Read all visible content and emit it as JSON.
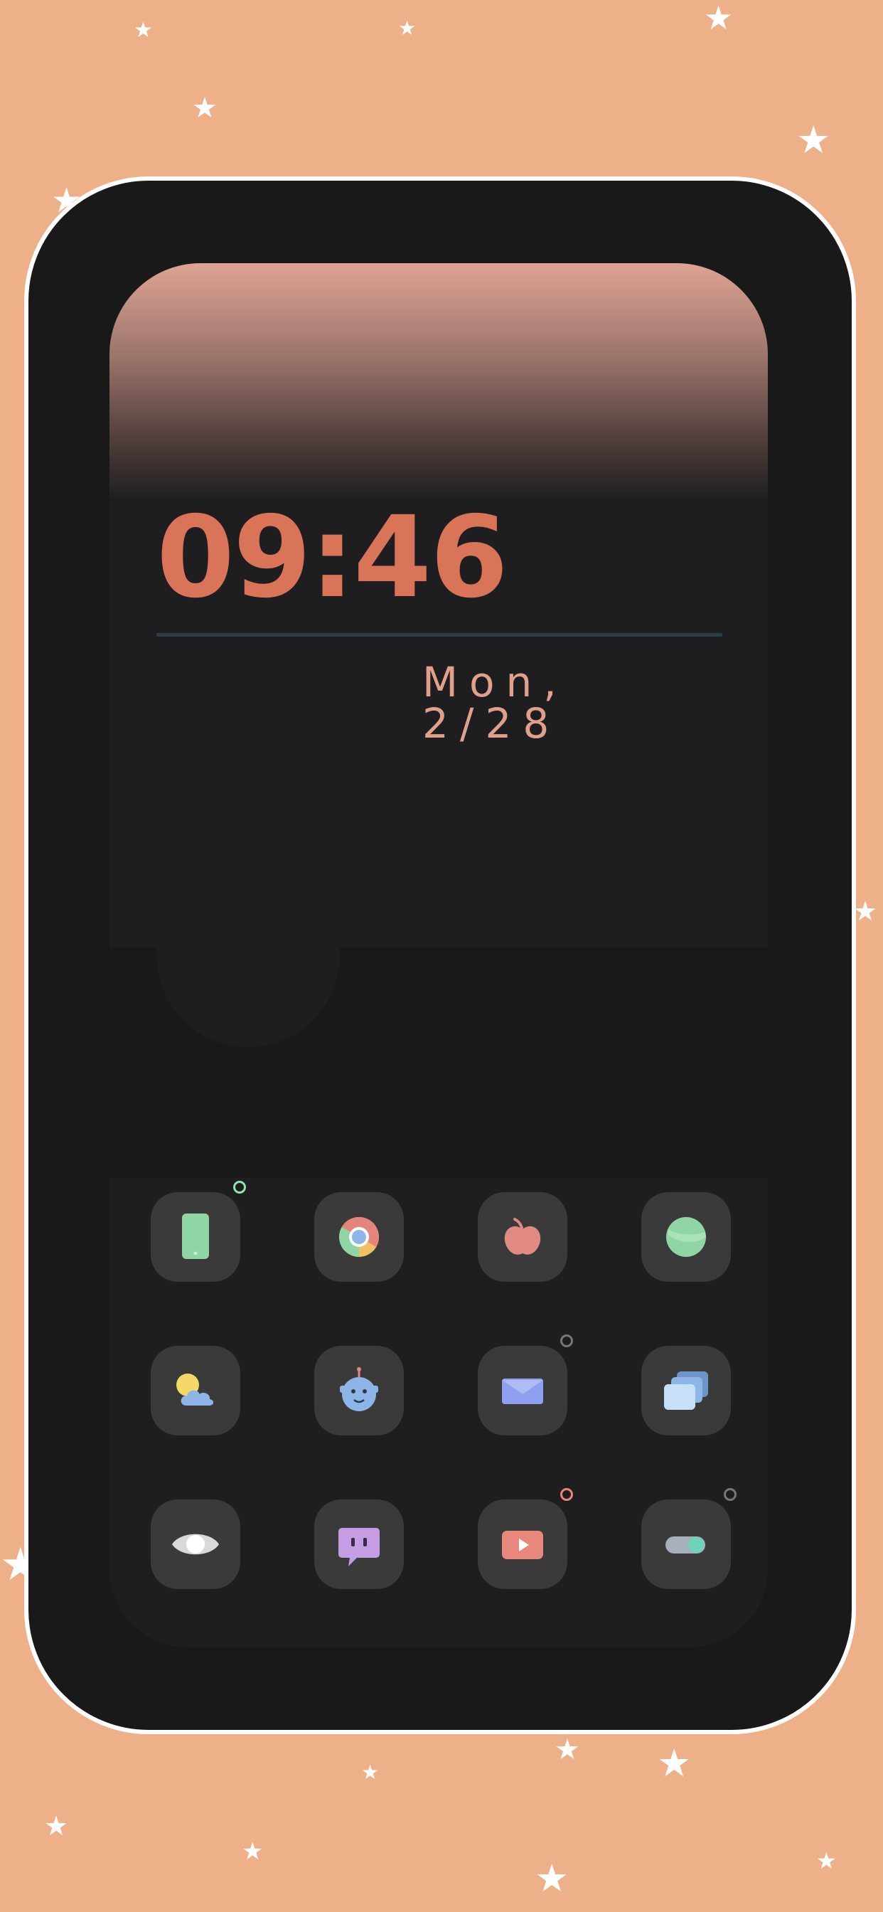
{
  "clock": {
    "time": "09:46",
    "date": "Mon, 2/28"
  },
  "weather_widget": {
    "icon": "crescent-moon-icon",
    "accent_color": "#d97458"
  },
  "colors": {
    "background": "#eeb088",
    "phone_body": "#191919",
    "widget": "#1e1e20",
    "clock_text": "#d97458",
    "date_text": "#e0a08b",
    "app_tile": "#3a3a3a"
  },
  "apps": [
    {
      "name": "phone",
      "icon": "phone-icon",
      "badge": "green-ring"
    },
    {
      "name": "chrome",
      "icon": "chrome-icon",
      "badge": "none"
    },
    {
      "name": "apple",
      "icon": "apple-icon",
      "badge": "none"
    },
    {
      "name": "circle-app",
      "icon": "green-circle-icon",
      "badge": "none"
    },
    {
      "name": "weather",
      "icon": "weather-icon",
      "badge": "none"
    },
    {
      "name": "robot",
      "icon": "robot-icon",
      "badge": "none"
    },
    {
      "name": "mail",
      "icon": "mail-icon",
      "badge": "gray-ring"
    },
    {
      "name": "gallery",
      "icon": "cards-icon",
      "badge": "none"
    },
    {
      "name": "eye",
      "icon": "eye-icon",
      "badge": "none"
    },
    {
      "name": "messages",
      "icon": "chat-icon",
      "badge": "none"
    },
    {
      "name": "youtube",
      "icon": "play-icon",
      "badge": "pink-ring"
    },
    {
      "name": "settings",
      "icon": "toggle-icon",
      "badge": "gray-ring"
    }
  ]
}
